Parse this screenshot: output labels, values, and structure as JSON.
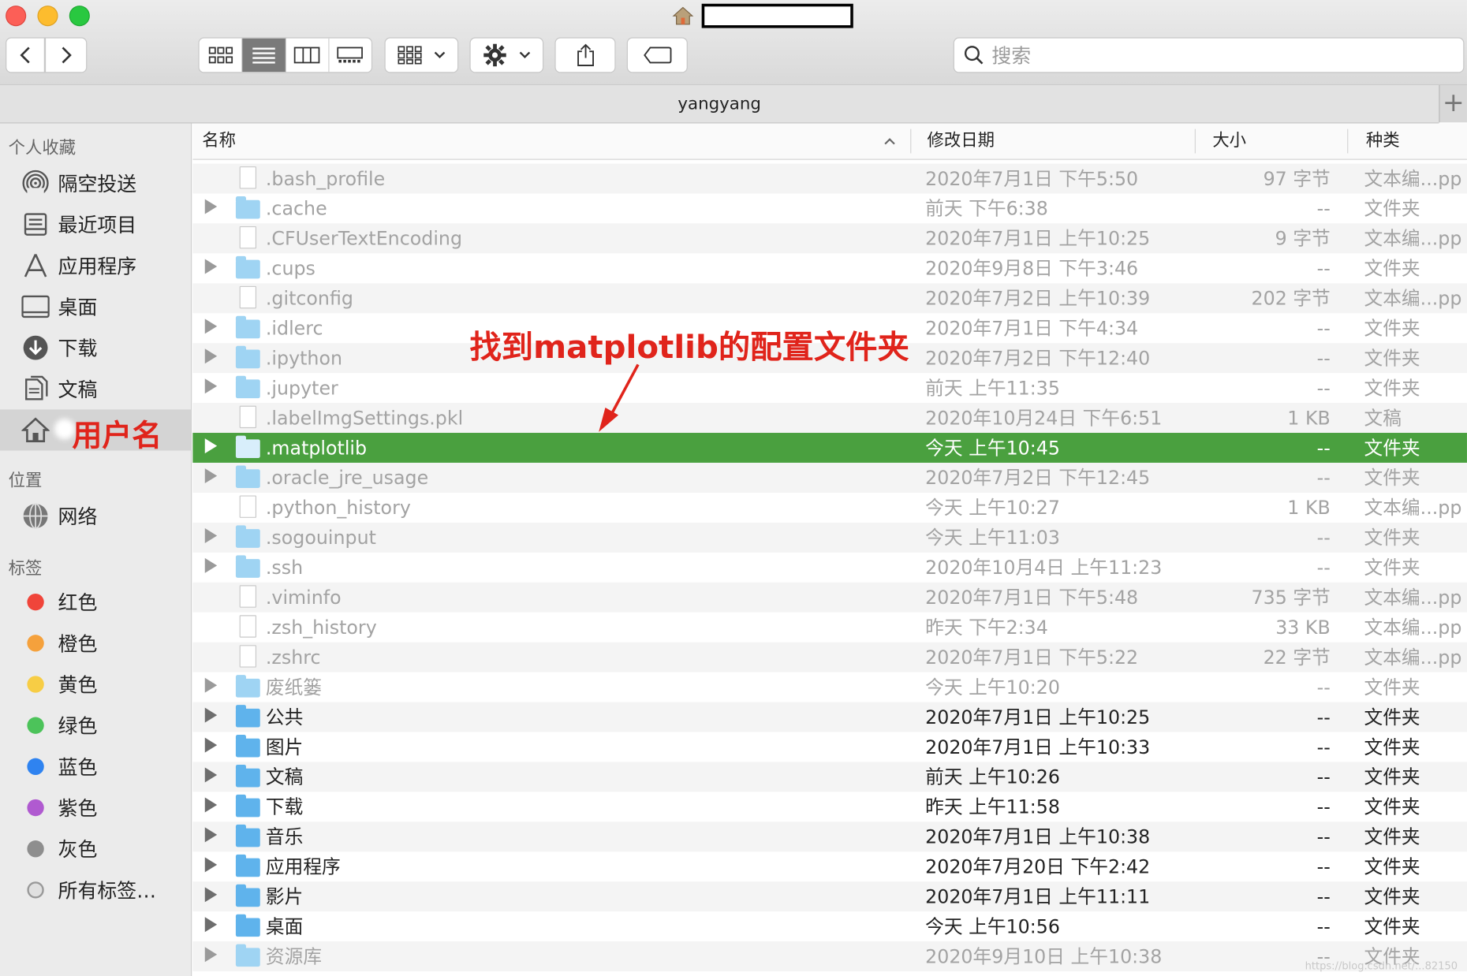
{
  "window": {
    "title": "",
    "path_title": "yangyang"
  },
  "toolbar": {
    "search_placeholder": "搜索"
  },
  "sidebar": {
    "favorites_heading": "个人收藏",
    "favorites": [
      {
        "label": "隔空投送",
        "icon": "airdrop-icon"
      },
      {
        "label": "最近项目",
        "icon": "recents-icon"
      },
      {
        "label": "应用程序",
        "icon": "applications-icon"
      },
      {
        "label": "桌面",
        "icon": "desktop-icon"
      },
      {
        "label": "下载",
        "icon": "download-icon"
      },
      {
        "label": "文稿",
        "icon": "documents-icon"
      },
      {
        "label": "",
        "icon": "home-icon"
      }
    ],
    "locations_heading": "位置",
    "locations": [
      {
        "label": "网络",
        "icon": "network-icon"
      }
    ],
    "tags_heading": "标签",
    "tags": [
      {
        "label": "红色",
        "color": "#f0453a"
      },
      {
        "label": "橙色",
        "color": "#f5a13c"
      },
      {
        "label": "黄色",
        "color": "#f7cd45"
      },
      {
        "label": "绿色",
        "color": "#4cc35a"
      },
      {
        "label": "蓝色",
        "color": "#2f83f0"
      },
      {
        "label": "紫色",
        "color": "#b05ad0"
      },
      {
        "label": "灰色",
        "color": "#8e8e8e"
      },
      {
        "label": "所有标签…",
        "color": "#d9d9d9"
      }
    ]
  },
  "columns": {
    "name": "名称",
    "date": "修改日期",
    "size": "大小",
    "kind": "种类"
  },
  "files": [
    {
      "name": ".bash_profile",
      "date": "2020年7月1日 下午5:50",
      "size": "97 字节",
      "kind": "文本编...pp",
      "type": "doc",
      "dim": true
    },
    {
      "name": ".cache",
      "date": "前天 下午6:38",
      "size": "--",
      "kind": "文件夹",
      "type": "folder",
      "dim": true
    },
    {
      "name": ".CFUserTextEncoding",
      "date": "2020年7月1日 上午10:25",
      "size": "9 字节",
      "kind": "文本编...pp",
      "type": "doc",
      "dim": true
    },
    {
      "name": ".cups",
      "date": "2020年9月8日 下午3:46",
      "size": "--",
      "kind": "文件夹",
      "type": "folder",
      "dim": true
    },
    {
      "name": ".gitconfig",
      "date": "2020年7月2日 上午10:39",
      "size": "202 字节",
      "kind": "文本编...pp",
      "type": "doc",
      "dim": true
    },
    {
      "name": ".idlerc",
      "date": "2020年7月1日 下午4:34",
      "size": "--",
      "kind": "文件夹",
      "type": "folder",
      "dim": true
    },
    {
      "name": ".ipython",
      "date": "2020年7月2日 下午12:40",
      "size": "--",
      "kind": "文件夹",
      "type": "folder",
      "dim": true
    },
    {
      "name": ".jupyter",
      "date": "前天 上午11:35",
      "size": "--",
      "kind": "文件夹",
      "type": "folder",
      "dim": true
    },
    {
      "name": ".labelImgSettings.pkl",
      "date": "2020年10月24日 下午6:51",
      "size": "1 KB",
      "kind": "文稿",
      "type": "doc",
      "dim": true
    },
    {
      "name": ".matplotlib",
      "date": "今天 上午10:45",
      "size": "--",
      "kind": "文件夹",
      "type": "folder",
      "dim": true,
      "selected": true
    },
    {
      "name": ".oracle_jre_usage",
      "date": "2020年7月2日 下午12:45",
      "size": "--",
      "kind": "文件夹",
      "type": "folder",
      "dim": true
    },
    {
      "name": ".python_history",
      "date": "今天 上午10:27",
      "size": "1 KB",
      "kind": "文本编...pp",
      "type": "doc",
      "dim": true
    },
    {
      "name": ".sogouinput",
      "date": "今天 上午11:03",
      "size": "--",
      "kind": "文件夹",
      "type": "folder",
      "dim": true
    },
    {
      "name": ".ssh",
      "date": "2020年10月4日 上午11:23",
      "size": "--",
      "kind": "文件夹",
      "type": "folder",
      "dim": true
    },
    {
      "name": ".viminfo",
      "date": "2020年7月1日 下午5:48",
      "size": "735 字节",
      "kind": "文本编...pp",
      "type": "doc",
      "dim": true
    },
    {
      "name": ".zsh_history",
      "date": "昨天 下午2:34",
      "size": "33 KB",
      "kind": "文本编...pp",
      "type": "doc",
      "dim": true
    },
    {
      "name": ".zshrc",
      "date": "2020年7月1日 下午5:22",
      "size": "22 字节",
      "kind": "文本编...pp",
      "type": "doc",
      "dim": true
    },
    {
      "name": "废纸篓",
      "date": "今天 上午10:20",
      "size": "--",
      "kind": "文件夹",
      "type": "folder",
      "dim": true
    },
    {
      "name": "公共",
      "date": "2020年7月1日 上午10:25",
      "size": "--",
      "kind": "文件夹",
      "type": "folder-dark",
      "dim": false
    },
    {
      "name": "图片",
      "date": "2020年7月1日 上午10:33",
      "size": "--",
      "kind": "文件夹",
      "type": "folder-dark",
      "dim": false
    },
    {
      "name": "文稿",
      "date": "前天 上午10:26",
      "size": "--",
      "kind": "文件夹",
      "type": "folder-dark",
      "dim": false
    },
    {
      "name": "下载",
      "date": "昨天 上午11:58",
      "size": "--",
      "kind": "文件夹",
      "type": "folder-dark",
      "dim": false
    },
    {
      "name": "音乐",
      "date": "2020年7月1日 上午10:38",
      "size": "--",
      "kind": "文件夹",
      "type": "folder-dark",
      "dim": false
    },
    {
      "name": "应用程序",
      "date": "2020年7月20日 下午2:42",
      "size": "--",
      "kind": "文件夹",
      "type": "folder-dark",
      "dim": false
    },
    {
      "name": "影片",
      "date": "2020年7月1日 上午11:11",
      "size": "--",
      "kind": "文件夹",
      "type": "folder-dark",
      "dim": false
    },
    {
      "name": "桌面",
      "date": "今天 上午10:56",
      "size": "--",
      "kind": "文件夹",
      "type": "folder-dark",
      "dim": false
    },
    {
      "name": "资源库",
      "date": "2020年9月10日 上午10:38",
      "size": "--",
      "kind": "文件夹",
      "type": "folder",
      "dim": true
    }
  ],
  "annotations": {
    "callout": "找到matplotlib的配置文件夹",
    "username_label": "用户名"
  },
  "watermark": "https://blog.csdn.net/...82150"
}
